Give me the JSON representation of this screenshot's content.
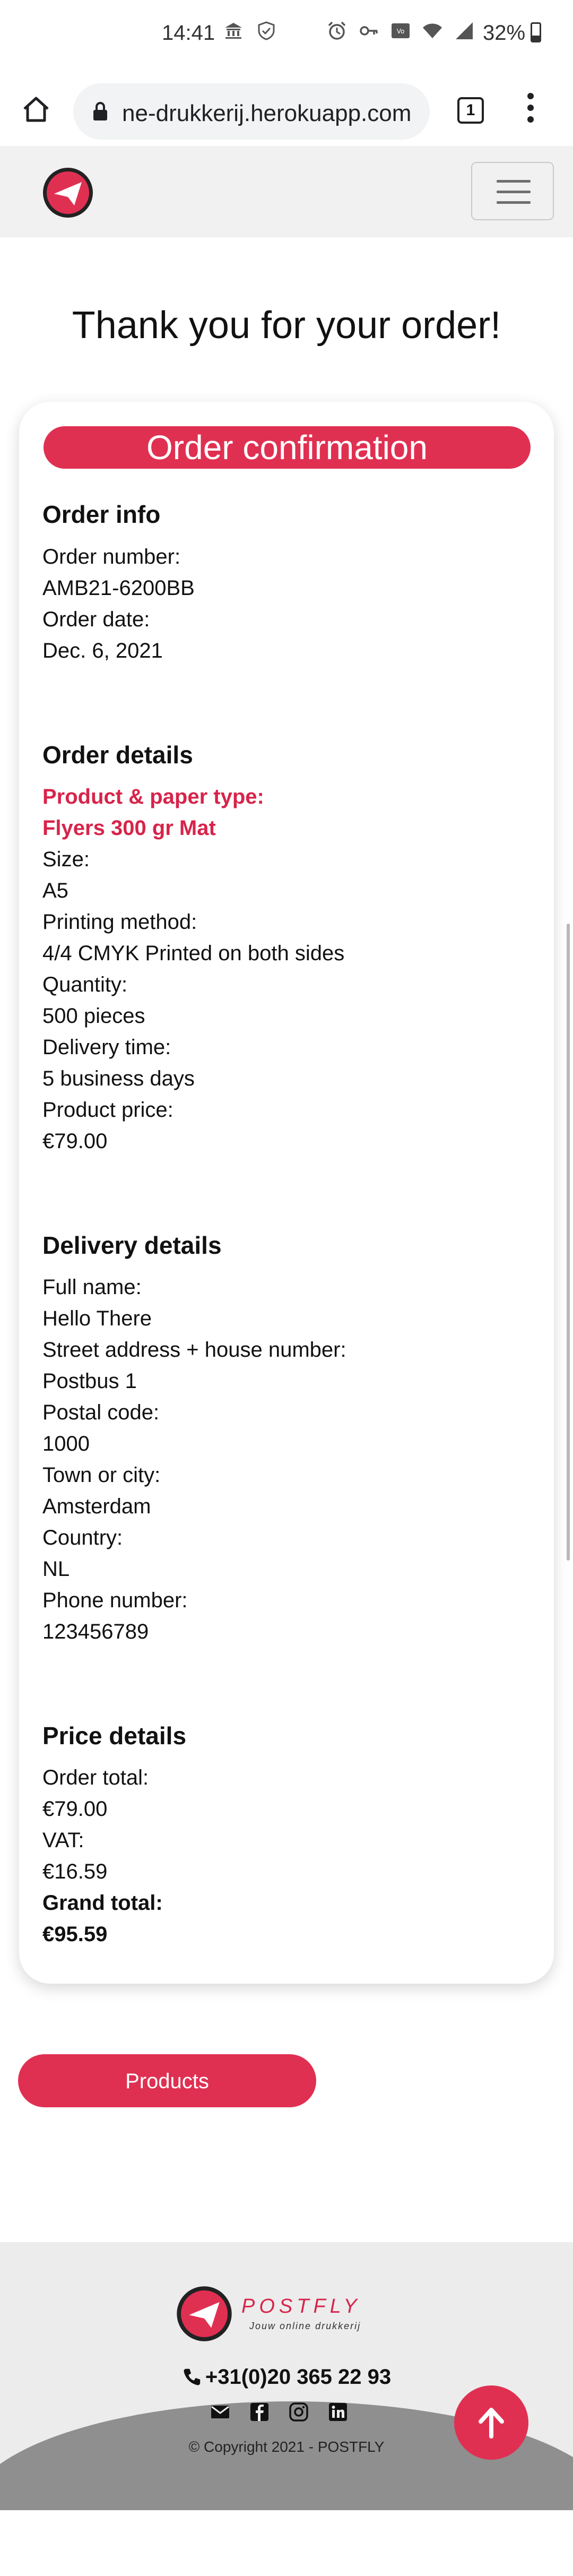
{
  "status_bar": {
    "time": "14:41",
    "battery": "32%"
  },
  "browser": {
    "url": "ne-drukkerij.herokuapp.com",
    "tab_count": "1"
  },
  "page": {
    "title": "Thank you for your order!",
    "card_header": "Order confirmation"
  },
  "order_info": {
    "heading": "Order info",
    "number_label": "Order number:",
    "number_value": "AMB21-6200BB",
    "date_label": "Order date:",
    "date_value": "Dec. 6, 2021"
  },
  "order_details": {
    "heading": "Order details",
    "product_label": "Product & paper type:",
    "product_value": "Flyers 300 gr Mat",
    "size_label": "Size:",
    "size_value": "A5",
    "method_label": "Printing method:",
    "method_value": "4/4 CMYK Printed on both sides",
    "quantity_label": "Quantity:",
    "quantity_value": "500 pieces",
    "delivery_label": "Delivery time:",
    "delivery_value": "5 business days",
    "price_label": "Product price:",
    "price_value": "€79.00"
  },
  "delivery_details": {
    "heading": "Delivery details",
    "name_label": "Full name:",
    "name_value": "Hello There",
    "street_label": "Street address + house number:",
    "street_value": "Postbus 1",
    "postal_label": "Postal code:",
    "postal_value": "1000",
    "town_label": "Town or city:",
    "town_value": "Amsterdam",
    "country_label": "Country:",
    "country_value": "NL",
    "phone_label": "Phone number:",
    "phone_value": "123456789"
  },
  "price_details": {
    "heading": "Price details",
    "total_label": "Order total:",
    "total_value": "€79.00",
    "vat_label": "VAT:",
    "vat_value": "€16.59",
    "grand_label": "Grand total:",
    "grand_value": "€95.59"
  },
  "actions": {
    "products_button": "Products"
  },
  "footer": {
    "brand": "POSTFLY",
    "tagline": "Jouw online drukkerij",
    "phone": "+31(0)20 365 22 93",
    "copyright": "© Copyright 2021 - POSTFLY"
  },
  "colors": {
    "accent": "#e03052",
    "accent_text": "#d7244a",
    "navbar_bg": "#f1f1f1",
    "footer_bg": "#ececec"
  },
  "icons": [
    "alarm-icon",
    "key-icon",
    "wifi-icon",
    "signal-icon",
    "battery-icon",
    "home-icon",
    "lock-icon",
    "tabs-icon",
    "overflow-menu-icon",
    "paper-plane-logo-icon",
    "hamburger-icon",
    "phone-icon",
    "envelope-icon",
    "facebook-icon",
    "instagram-icon",
    "linkedin-icon",
    "arrow-up-icon"
  ]
}
